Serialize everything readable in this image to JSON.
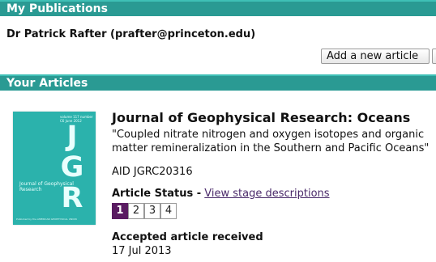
{
  "header": {
    "title": "My Publications"
  },
  "user": {
    "line": "Dr Patrick Rafter (prafter@princeton.edu)"
  },
  "actions": {
    "add_article": "Add a new article",
    "partial": ""
  },
  "section": {
    "title": "Your Articles"
  },
  "cover": {
    "vol_info": "volume 117 number C6 June 2012",
    "letters": "JGR",
    "journal_small": "Journal of Geophysical Research",
    "footer": "Published by the AMERICAN GEOPHYSICAL UNION"
  },
  "article": {
    "journal": "Journal of Geophysical Research: Oceans",
    "title": "\"Coupled nitrate nitrogen and oxygen isotopes and organic matter remineralization in the Southern and Pacific Oceans\"",
    "aid": "AID JGRC20316",
    "status_label": "Article Status -",
    "status_link": "View stage descriptions",
    "stages": [
      "1",
      "2",
      "3",
      "4"
    ],
    "accepted_label": "Accepted article received",
    "accepted_date": "17 Jul 2013"
  }
}
